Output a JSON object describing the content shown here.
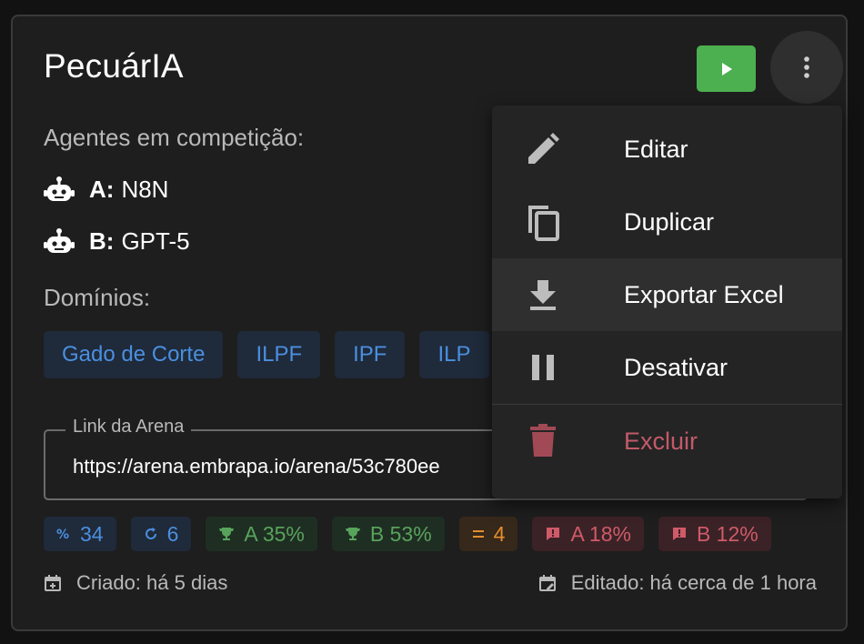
{
  "card": {
    "title": "PecuárIA",
    "agents_label": "Agentes em competição:",
    "agents": [
      {
        "key": "A:",
        "name": "N8N"
      },
      {
        "key": "B:",
        "name": "GPT-5"
      }
    ],
    "domains_label": "Domínios:",
    "domains": [
      "Gado de Corte",
      "ILPF",
      "IPF",
      "ILP"
    ],
    "link_legend": "Link da Arena",
    "link_value": "https://arena.embrapa.io/arena/53c780ee",
    "stats": [
      {
        "icon": "percent-icon",
        "text": "34",
        "tone": "blue"
      },
      {
        "icon": "refresh-icon",
        "text": "6",
        "tone": "blue"
      },
      {
        "icon": "trophy-icon",
        "text": "A 35%",
        "tone": "green"
      },
      {
        "icon": "trophy-icon",
        "text": "B 53%",
        "tone": "green"
      },
      {
        "icon": "equals-icon",
        "text": "4",
        "tone": "orange"
      },
      {
        "icon": "alert-icon",
        "text": "A 18%",
        "tone": "red"
      },
      {
        "icon": "alert-icon",
        "text": "B 12%",
        "tone": "red"
      }
    ],
    "created": "Criado: há 5 dias",
    "edited": "Editado: há cerca de 1 hora"
  },
  "menu": {
    "items": [
      {
        "label": "Editar",
        "icon": "pencil-icon"
      },
      {
        "label": "Duplicar",
        "icon": "copy-icon"
      },
      {
        "label": "Exportar Excel",
        "icon": "download-icon"
      },
      {
        "label": "Desativar",
        "icon": "pause-icon"
      },
      {
        "label": "Excluir",
        "icon": "trash-icon"
      }
    ]
  },
  "colors": {
    "accent_green": "#4caf50",
    "chip_blue": "#4a8fe0",
    "danger": "#c25a6a"
  }
}
